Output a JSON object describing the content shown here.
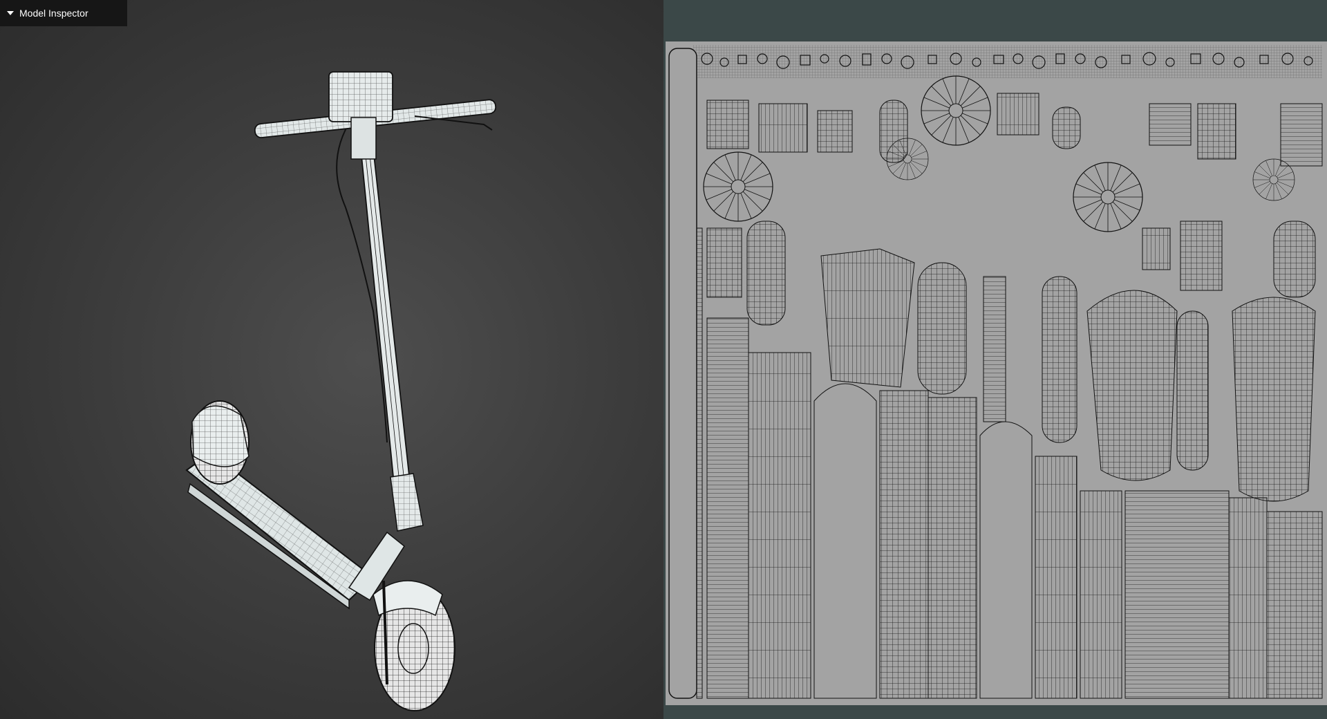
{
  "inspector": {
    "title": "Model Inspector",
    "caret_icon": "caret-down-icon"
  },
  "colors": {
    "viewport_bg": "#3e3e3e",
    "uv_panel_bg": "#3b4848",
    "uv_sheet": "#a3a3a3",
    "wire": "#1a1a1a",
    "model_fill": "#dfe6e6"
  },
  "viewport": {
    "subject": "electric-scooter-wireframe"
  },
  "uv_layout": {
    "description_icon": "uv-islands"
  }
}
